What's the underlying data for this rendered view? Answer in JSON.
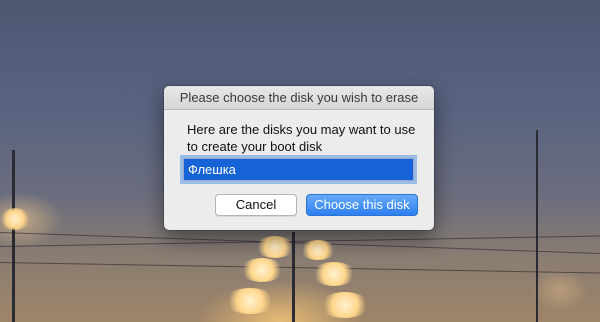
{
  "dialog": {
    "title": "Please choose the disk you wish to erase",
    "prompt": "Here are the disks you may want to use to create your boot disk",
    "disks": [
      "Флешка"
    ],
    "selected_index": 0,
    "cancel_label": "Cancel",
    "choose_label": "Choose this disk"
  },
  "colors": {
    "selection": "#1663d8",
    "default_button": "#2d7ef0",
    "dialog_bg": "#ececec"
  }
}
